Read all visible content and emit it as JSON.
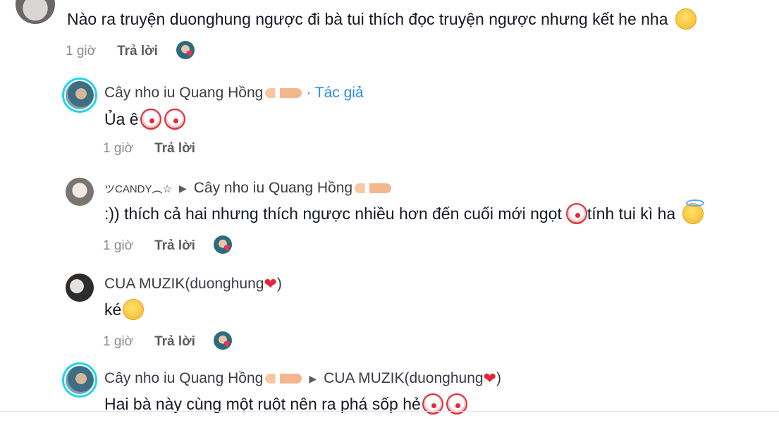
{
  "top_comment": {
    "text": "Nào ra truyện duonghung ngược đi bà tui thích đọc truyện ngược nhưng kết he nha",
    "emoji": "smiling-face-with-hearts",
    "time": "1 giờ",
    "reply": "Trả lời"
  },
  "replies": [
    {
      "author": "Cây nho iu Quang Hồng",
      "badge": "· Tác giả",
      "text": "Ủa ê",
      "time": "1 giờ",
      "reply": "Trả lời"
    },
    {
      "author": "ツCANDY︵☆",
      "reply_to": "Cây nho iu Quang Hồng",
      "text_a": ":)) thích cả hai nhưng thích ngược nhiều hơn đến cuối mới ngọt",
      "text_b": "tính tui kì ha",
      "time": "1 giờ",
      "reply": "Trả lời"
    },
    {
      "author": "CUA MUZIK(duonghung",
      "author_suffix": ")",
      "text": "ké",
      "time": "1 giờ",
      "reply": "Trả lời"
    },
    {
      "author": "Cây nho iu Quang Hồng",
      "reply_to": "CUA MUZIK(duonghung",
      "reply_to_suffix": ")",
      "text": "Hai bà này cùng một ruột nên ra phá sốp hẻ"
    }
  ],
  "colors": {
    "author_ring": "#20d5ec",
    "author_tag": "#2b8be8",
    "heart": "#e32636"
  }
}
